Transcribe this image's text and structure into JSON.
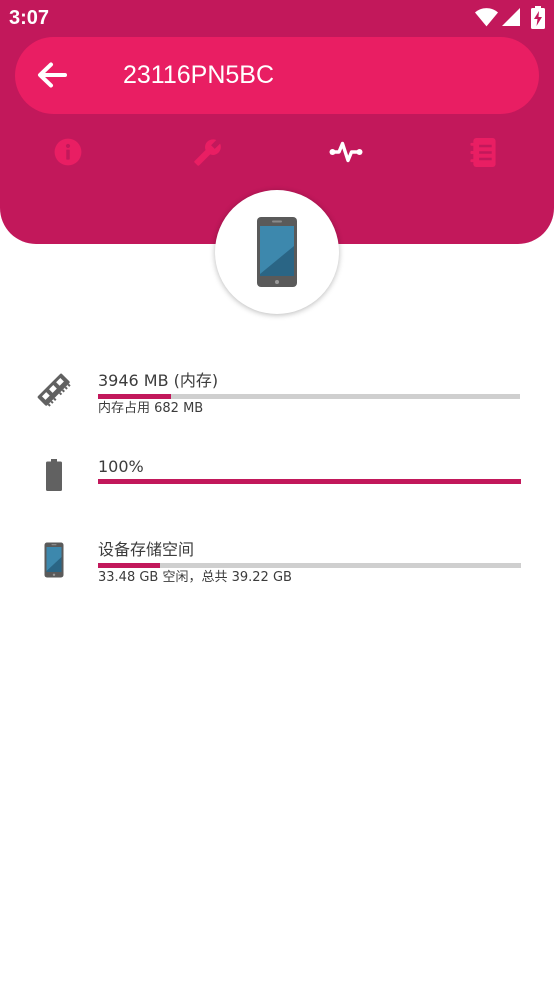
{
  "status_bar": {
    "time": "3:07",
    "icons": [
      "wifi-icon",
      "signal-icon",
      "battery-charging-icon"
    ]
  },
  "toolbar": {
    "back_icon": "arrow-left-icon",
    "title": "23116PN5BC"
  },
  "tabs": [
    {
      "icon": "info-icon",
      "selected": false
    },
    {
      "icon": "wrench-icon",
      "selected": false
    },
    {
      "icon": "pulse-icon",
      "selected": true
    },
    {
      "icon": "notebook-icon",
      "selected": false
    }
  ],
  "device": {
    "icon": "phone-icon"
  },
  "stats": [
    {
      "icon": "memory-icon",
      "title": "3946 MB (内存)",
      "progress": 0.173,
      "subtitle": "内存占用 682 MB"
    },
    {
      "icon": "battery-icon",
      "title": "100%",
      "progress": 1.0
    },
    {
      "icon": "phone-icon",
      "title": "设备存储空间",
      "progress": 0.146,
      "subtitle": "33.48 GB 空闲，总共 39.22 GB"
    }
  ],
  "colors": {
    "header": "#C2185B",
    "toolbar": "#E91E63",
    "accent": "#C2185B",
    "track": "#CFCFCF",
    "tab_inactive": "#E91E63",
    "tab_active": "#FFFFFF",
    "text": "#3C3C3C",
    "icon": "#616161"
  }
}
